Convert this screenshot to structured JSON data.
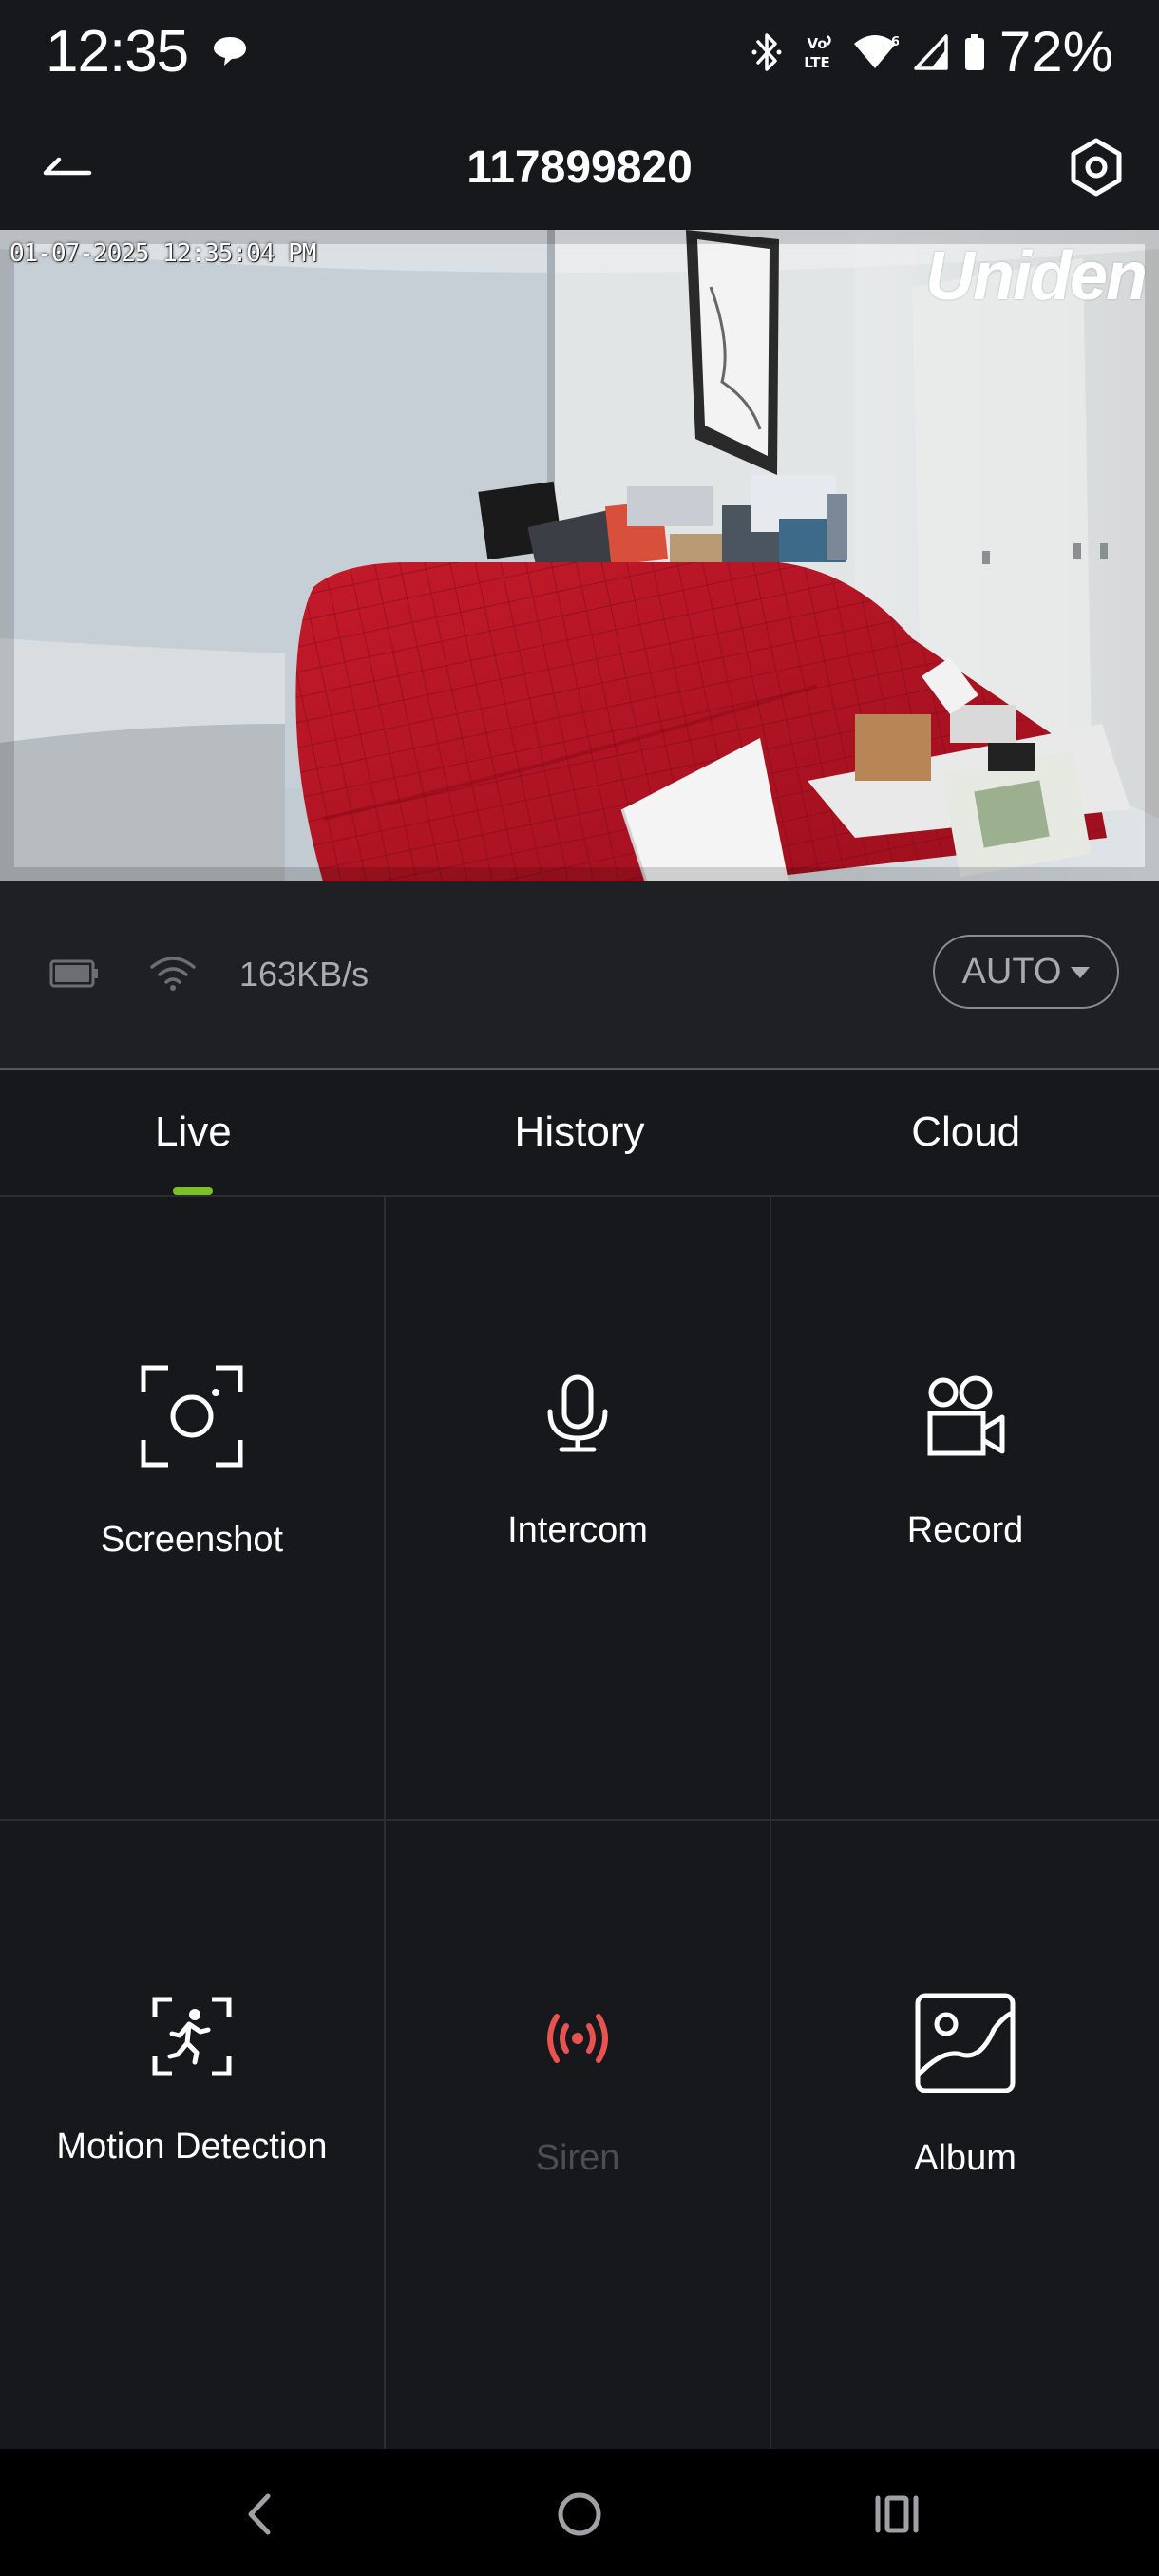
{
  "status_bar": {
    "time": "12:35",
    "battery_percent": "72%",
    "icons": [
      "chat-bubble-icon",
      "bluetooth-icon",
      "volte-icon",
      "wifi-icon",
      "cellular-signal-icon",
      "battery-icon"
    ]
  },
  "app_bar": {
    "title": "117899820",
    "back_icon": "back-arrow-icon",
    "settings_icon": "settings-icon"
  },
  "feed": {
    "timestamp": "01-07-2025 12:35:04 PM",
    "logo": "Uniden"
  },
  "stream": {
    "speed": "163KB/s",
    "quality": "AUTO",
    "icons": [
      "battery-icon",
      "wifi-icon"
    ]
  },
  "tabs": [
    {
      "label": "Live",
      "active": true
    },
    {
      "label": "History",
      "active": false
    },
    {
      "label": "Cloud",
      "active": false
    }
  ],
  "controls": [
    {
      "label": "Screenshot",
      "icon": "screenshot-icon",
      "enabled": true
    },
    {
      "label": "Intercom",
      "icon": "microphone-icon",
      "enabled": true
    },
    {
      "label": "Record",
      "icon": "video-record-icon",
      "enabled": true
    },
    {
      "label": "Motion Detection",
      "icon": "motion-detection-icon",
      "enabled": true
    },
    {
      "label": "Siren",
      "icon": "siren-icon",
      "enabled": false,
      "icon_color": "#e8534f"
    },
    {
      "label": "Album",
      "icon": "album-icon",
      "enabled": true
    }
  ],
  "nav_bar": {
    "icons": [
      "back-nav-icon",
      "home-nav-icon",
      "recents-nav-icon"
    ]
  },
  "colors": {
    "background": "#17181c",
    "tab_indicator": "#7bbf2a",
    "siren": "#e8534f"
  }
}
